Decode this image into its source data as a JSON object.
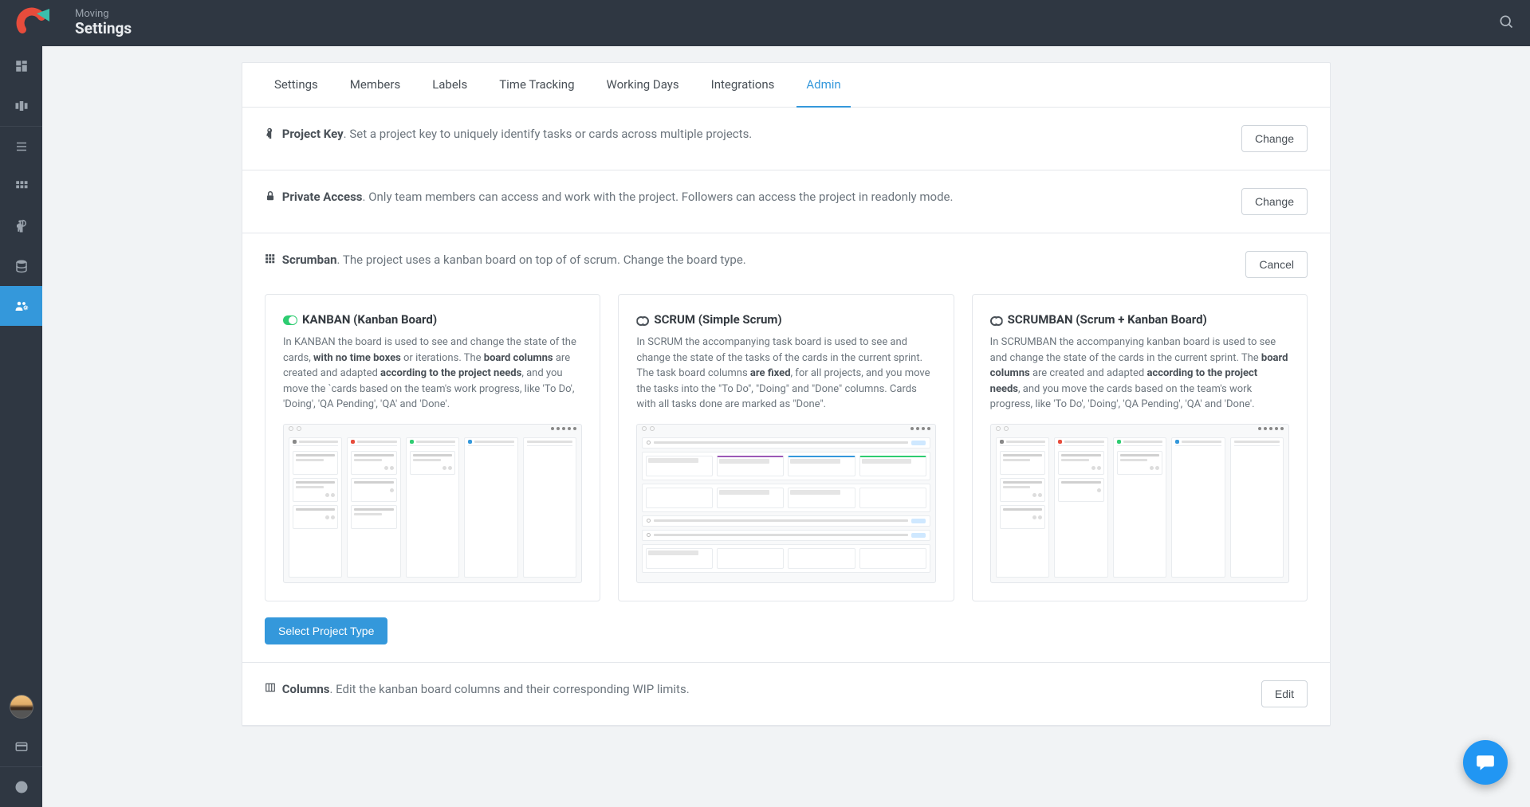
{
  "header": {
    "breadcrumb": "Moving",
    "title": "Settings"
  },
  "tabs": [
    {
      "label": "Settings"
    },
    {
      "label": "Members"
    },
    {
      "label": "Labels"
    },
    {
      "label": "Time Tracking"
    },
    {
      "label": "Working Days"
    },
    {
      "label": "Integrations"
    },
    {
      "label": "Admin",
      "active": true
    }
  ],
  "sections": {
    "project_key": {
      "title": "Project Key",
      "desc": ". Set a project key to uniquely identify tasks or cards across multiple projects.",
      "button": "Change"
    },
    "private_access": {
      "title": "Private Access",
      "desc": ". Only team members can access and work with the project. Followers can access the project in readonly mode.",
      "button": "Change"
    },
    "scrumban": {
      "title": "Scrumban",
      "desc": ". The project uses a kanban board on top of of scrum. Change the board type.",
      "button": "Cancel",
      "select_label": "Select Project Type"
    },
    "columns": {
      "title": "Columns",
      "desc": ". Edit the kanban board columns and their corresponding WIP limits.",
      "button": "Edit"
    }
  },
  "types": {
    "kanban": {
      "title": "KANBAN (Kanban Board)",
      "desc": [
        "In KANBAN the board is used to see and change the state of the cards, ",
        "with no time boxes",
        " or iterations. The ",
        "board columns",
        " are created and adapted ",
        "according to the project needs",
        ", and you move the `cards based on the team's work progress, like 'To Do', 'Doing', 'QA Pending', 'QA' and 'Done'."
      ]
    },
    "scrum": {
      "title": "SCRUM (Simple Scrum)",
      "desc": [
        "In SCRUM the accompanying task board is used to see and change the state of the tasks of the cards in the current sprint. The task board columns ",
        "are fixed",
        ", for all projects, and you move the tasks into the \"To Do\", \"Doing\" and \"Done\" columns. Cards with all tasks done are marked as \"Done\"."
      ]
    },
    "scrumban": {
      "title": "SCRUMBAN (Scrum + Kanban Board)",
      "desc": [
        "In SCRUMBAN the accompanying kanban board is used to see and change the state of the cards in the current sprint. The ",
        "board columns",
        " are created and adapted ",
        "according to the project needs",
        ", and you move the cards based on the team's work progress, like 'To Do', 'Doing', 'QA Pending', 'QA' and 'Done'."
      ]
    }
  }
}
